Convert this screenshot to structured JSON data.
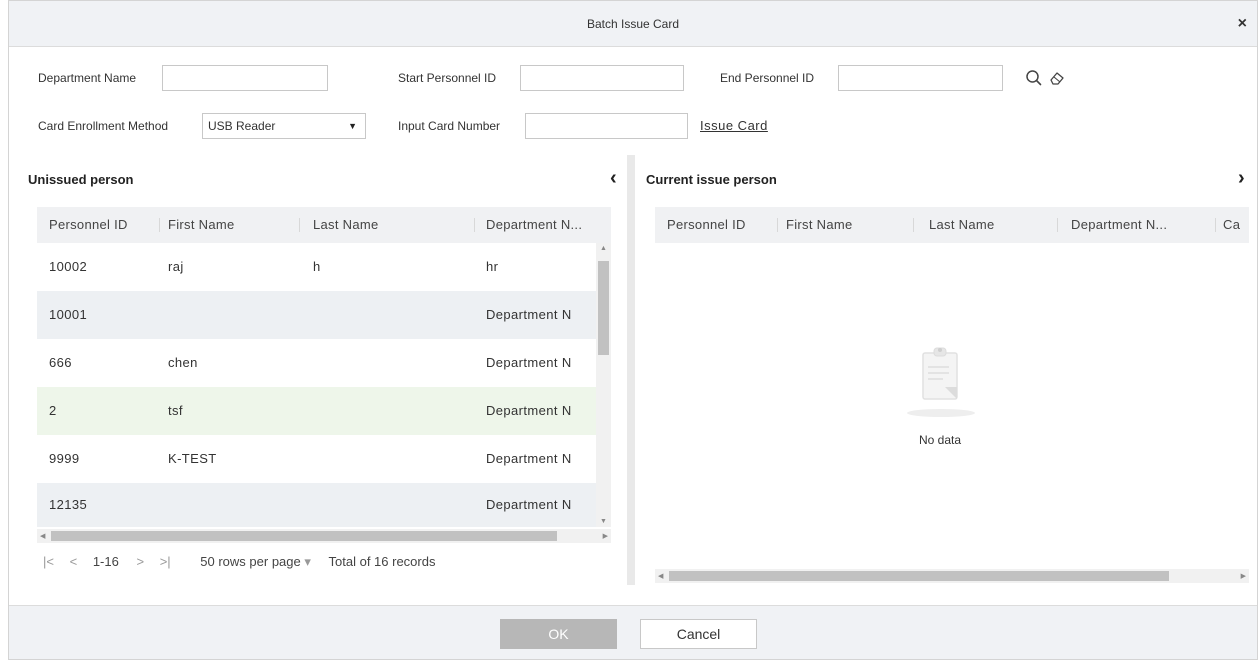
{
  "dialog": {
    "title": "Batch Issue Card",
    "close_glyph": "×"
  },
  "filters": {
    "department_name_label": "Department Name",
    "department_name_value": "",
    "start_id_label": "Start Personnel ID",
    "start_id_value": "",
    "end_id_label": "End Personnel ID",
    "end_id_value": "",
    "enroll_method_label": "Card Enrollment Method",
    "enroll_method_value": "USB Reader",
    "input_card_label": "Input Card Number",
    "input_card_value": "",
    "issue_card_link": "Issue Card",
    "search_icon": "search-icon",
    "clear_icon": "eraser-icon"
  },
  "left_panel": {
    "title": "Unissued person",
    "collapse_glyph": "‹",
    "columns": [
      "Personnel ID",
      "First Name",
      "Last Name",
      "Department N..."
    ],
    "rows": [
      [
        "10002",
        "raj",
        "h",
        "hr"
      ],
      [
        "10001",
        "",
        "",
        "Department N"
      ],
      [
        "666",
        "chen",
        "",
        "Department N"
      ],
      [
        "2",
        "tsf",
        "",
        "Department N"
      ],
      [
        "9999",
        "K-TEST",
        "",
        "Department N"
      ],
      [
        "12135",
        "",
        "",
        "Department N"
      ]
    ],
    "pager": {
      "first": "|<",
      "prev": "<",
      "range": "1-16",
      "next": ">",
      "last": ">|",
      "rows_per_page": "50 rows per page",
      "rows_caret": "▾",
      "total": "Total of 16 records"
    }
  },
  "right_panel": {
    "title": "Current issue person",
    "expand_glyph": "›",
    "columns": [
      "Personnel ID",
      "First Name",
      "Last Name",
      "Department N...",
      "Ca"
    ],
    "empty_text": "No data",
    "empty_icon": "clipboard-icon"
  },
  "footer": {
    "ok_label": "OK",
    "cancel_label": "Cancel"
  },
  "colors": {
    "header_bg": "#f0f2f5",
    "row_alt": "#edf0f3",
    "row_highlight": "#eef6ea",
    "ok_disabled": "#b7b7b7"
  }
}
